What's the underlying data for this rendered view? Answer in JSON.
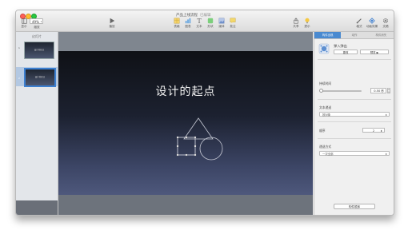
{
  "window": {
    "title": "产品上线流程",
    "subtitle": "已编辑",
    "colors": {
      "close": "#ff5f57",
      "minimize": "#febc2e",
      "zoom": "#28c840",
      "accent": "#4a8ad0"
    }
  },
  "toolbar": {
    "view_label": "显示",
    "zoom_value": "49%",
    "zoom_label": "缩放",
    "play_label": "播放",
    "insert_items": [
      {
        "label": "表格",
        "icon": "table-icon"
      },
      {
        "label": "图表",
        "icon": "chart-icon"
      },
      {
        "label": "文本",
        "icon": "text-icon"
      },
      {
        "label": "形状",
        "icon": "shape-icon"
      },
      {
        "label": "媒体",
        "icon": "media-icon"
      },
      {
        "label": "批注",
        "icon": "comment-icon"
      }
    ],
    "share_label": "共享",
    "tips_label": "提示",
    "format_label": "格式",
    "animate_label": "动画效果",
    "document_label": "文稿"
  },
  "navigator": {
    "title": "幻灯片",
    "slides": [
      {
        "number": "1",
        "thumb_text": "设计的起点"
      },
      {
        "number": "2",
        "thumb_text": "设计的起点"
      }
    ]
  },
  "slide": {
    "title": "设计的起点"
  },
  "inspector": {
    "tabs": [
      "构件出现",
      "动作",
      "构件消失"
    ],
    "active_tab": 0,
    "effect_name": "弹入弹出",
    "change_button": "更改",
    "preview_small": "预览",
    "duration_label": "持续时间",
    "duration_value": "0.50 秒",
    "text_delivery_label": "文本递送",
    "text_delivery_value": "按对象",
    "order_label": "顺序",
    "order_value": "2",
    "build_style_label": "递送方式",
    "build_style_value": "一次全部",
    "build_order_button": "构件顺序"
  }
}
